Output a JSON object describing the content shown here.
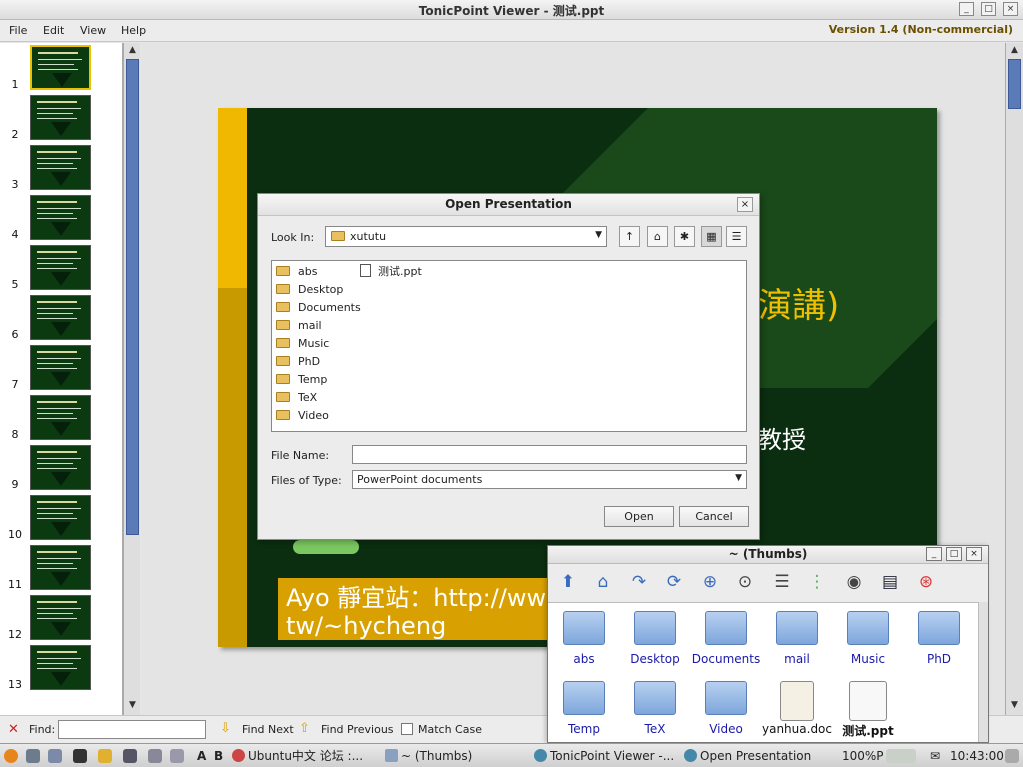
{
  "app": {
    "title": "TonicPoint Viewer - 测试.ppt",
    "version": "Version 1.4 (Non-commercial)",
    "menu": [
      "File",
      "Edit",
      "View",
      "Help"
    ]
  },
  "thumbnails": [
    "1",
    "2",
    "3",
    "4",
    "5",
    "6",
    "7",
    "8",
    "9",
    "10",
    "11",
    "12",
    "13"
  ],
  "slide": {
    "heading": "演講)",
    "professor": "教授",
    "caption_line1": "Ayo 靜宜站：http://ww",
    "caption_line2": "tw/~hycheng"
  },
  "find": {
    "label": "Find:",
    "next": "Find Next",
    "previous": "Find Previous",
    "match_case": "Match Case"
  },
  "dialog": {
    "title": "Open Presentation",
    "look_in_label": "Look In:",
    "look_in_value": "xututu",
    "folders": [
      "abs",
      "Desktop",
      "Documents",
      "mail",
      "Music",
      "PhD",
      "Temp",
      "TeX",
      "Video"
    ],
    "files": [
      "测试.ppt"
    ],
    "file_name_label": "File Name:",
    "file_name_value": "",
    "files_of_type_label": "Files of Type:",
    "files_of_type_value": "PowerPoint documents",
    "open_button": "Open",
    "cancel_button": "Cancel"
  },
  "file_manager": {
    "title": "~ (Thumbs)",
    "items": [
      "abs",
      "Desktop",
      "Documents",
      "mail",
      "Music",
      "PhD",
      "Temp",
      "TeX",
      "Video",
      "yanhua.doc",
      "测试.ppt"
    ]
  },
  "taskbar": {
    "items": [
      "Ubuntu中文 论坛 :...",
      "~ (Thumbs)",
      "TonicPoint Viewer -...",
      "Open Presentation"
    ],
    "cpu": "100%P",
    "clock": "10:43:00",
    "tray_letters": [
      "A",
      "B"
    ]
  }
}
